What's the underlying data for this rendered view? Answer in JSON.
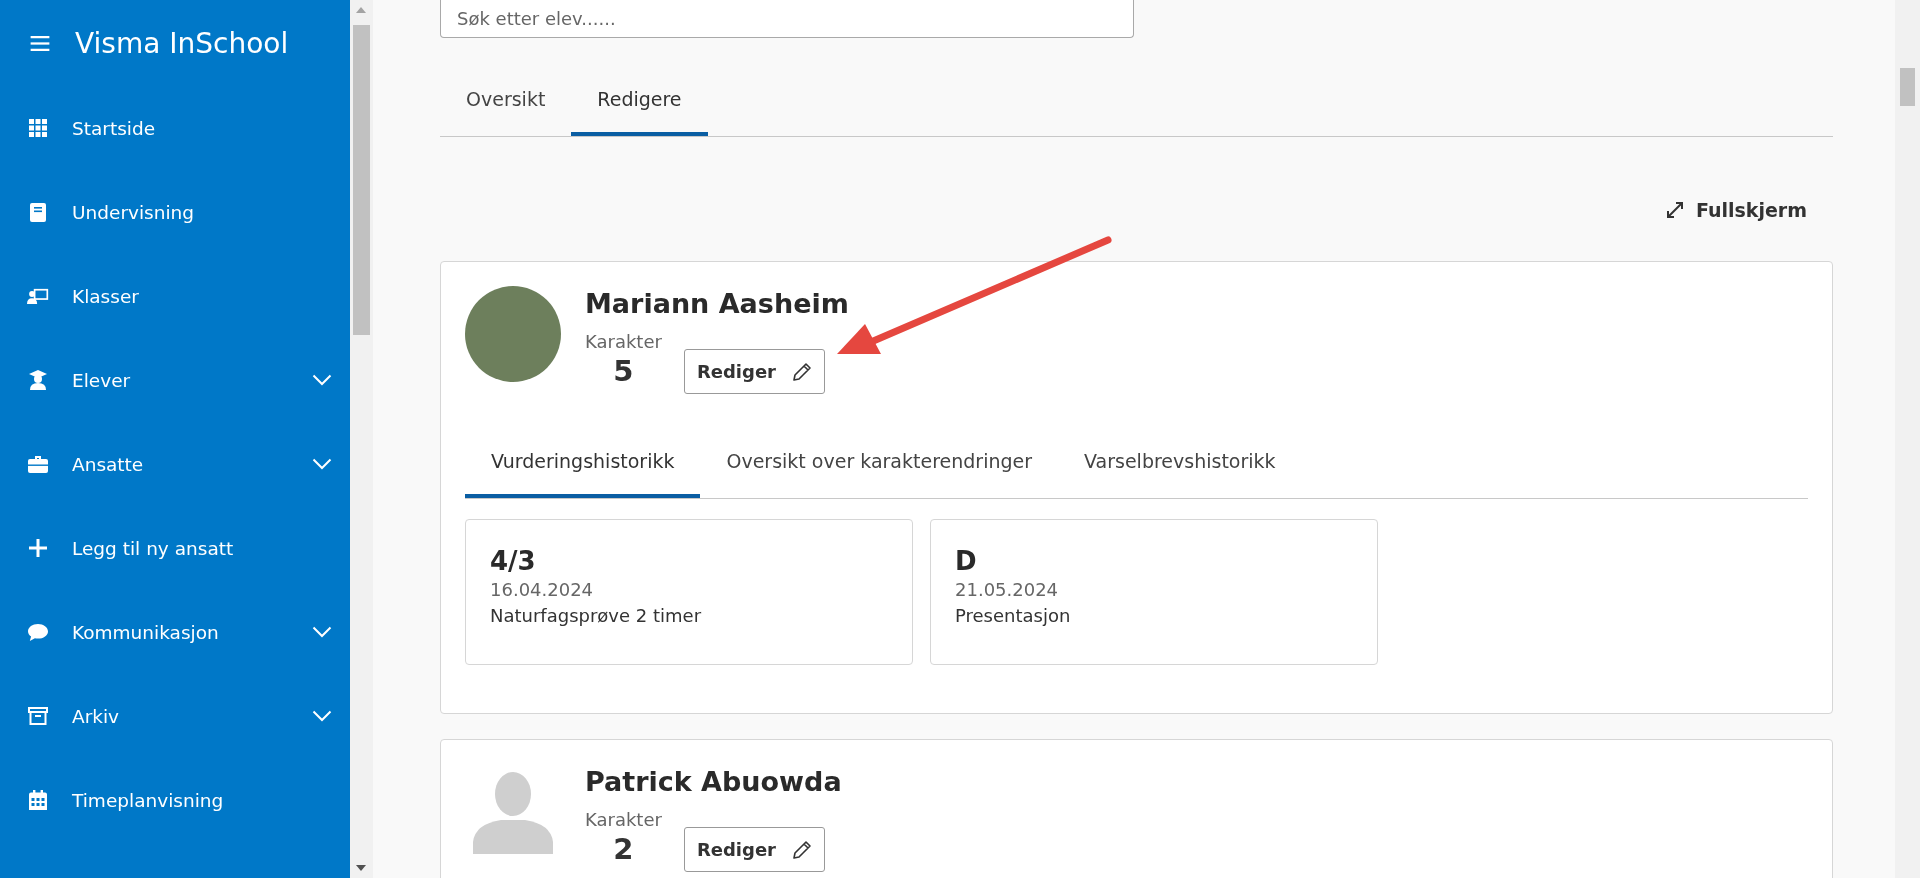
{
  "sidebar": {
    "title": "Visma InSchool",
    "items": [
      {
        "label": "Startside",
        "has_submenu": false
      },
      {
        "label": "Undervisning",
        "has_submenu": false
      },
      {
        "label": "Klasser",
        "has_submenu": false
      },
      {
        "label": "Elever",
        "has_submenu": true
      },
      {
        "label": "Ansatte",
        "has_submenu": true
      },
      {
        "label": "Legg til ny ansatt",
        "has_submenu": false
      },
      {
        "label": "Kommunikasjon",
        "has_submenu": true
      },
      {
        "label": "Arkiv",
        "has_submenu": true
      },
      {
        "label": "Timeplanvisning",
        "has_submenu": false
      }
    ]
  },
  "search": {
    "placeholder": "Søk etter elev......"
  },
  "view_tabs": [
    {
      "label": "Oversikt",
      "selected": false
    },
    {
      "label": "Redigere",
      "selected": true
    }
  ],
  "fullscreen_button": "Fullskjerm",
  "students": [
    {
      "name": "Mariann Aasheim",
      "kind": "photo",
      "grade_label": "Karakter",
      "grade": "5",
      "edit_button": "Rediger",
      "tabs": [
        {
          "label": "Vurderingshistorikk",
          "selected": true
        },
        {
          "label": "Oversikt over karakterendringer",
          "selected": false
        },
        {
          "label": "Varselbrevshistorikk",
          "selected": false
        }
      ],
      "assessments": [
        {
          "grade": "4/3",
          "date": "16.04.2024",
          "title": "Naturfagsprøve 2 timer"
        },
        {
          "grade": "D",
          "date": "21.05.2024",
          "title": "Presentasjon"
        }
      ]
    },
    {
      "name": "Patrick Abuowda",
      "kind": "silhouette",
      "grade_label": "Karakter",
      "grade": "2",
      "edit_button": "Rediger"
    }
  ]
}
